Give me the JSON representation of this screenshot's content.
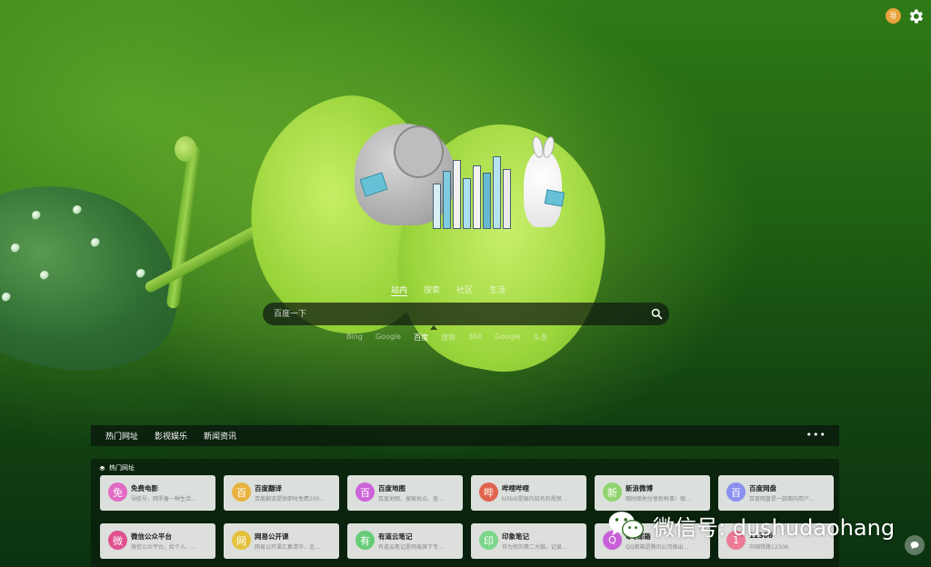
{
  "header": {
    "avatar_text": "导",
    "settings_icon": "gear-icon"
  },
  "search": {
    "tabs": [
      "站内",
      "搜索",
      "社区",
      "生活"
    ],
    "active_tab": "站内",
    "placeholder": "百度一下",
    "engines": [
      "Bing",
      "Google",
      "百度",
      "搜狗",
      "360",
      "Google",
      "头条"
    ],
    "active_engine": "百度"
  },
  "nav": {
    "tabs": [
      "热门网址",
      "影视娱乐",
      "新闻资讯"
    ],
    "more_label": "•••"
  },
  "panel": {
    "title": "热门网址",
    "cards": [
      {
        "icon": "免",
        "name": "免费电影",
        "desc": "导航号，网罗着一种生活…",
        "color": "#e06ac4"
      },
      {
        "icon": "百",
        "name": "百度翻译",
        "desc": "百度翻译提供即时免费200…",
        "color": "#e9b23f"
      },
      {
        "icon": "百",
        "name": "百度地图",
        "desc": "百度地图，搜索地点、查…",
        "color": "#cc64d9"
      },
      {
        "icon": "哔",
        "name": "哔哩哔哩",
        "desc": "bilibili是国内知名的视频…",
        "color": "#e0644d"
      },
      {
        "icon": "新",
        "name": "新浪微博",
        "desc": "随时随地分享新鲜事！微…",
        "color": "#8fd46f"
      },
      {
        "icon": "百",
        "name": "百度网盘",
        "desc": "百度网盘是一款面向用户…",
        "color": "#8a8ff0"
      },
      {
        "icon": "微",
        "name": "微信公众平台",
        "desc": "微信公众平台，给个人、…",
        "color": "#e0518e"
      },
      {
        "icon": "网",
        "name": "网易公开课",
        "desc": "网易公开课汇集清华、北…",
        "color": "#e4c23b"
      },
      {
        "icon": "有",
        "name": "有道云笔记",
        "desc": "有道云笔记是网易旗下专…",
        "color": "#67cc77"
      },
      {
        "icon": "印",
        "name": "印象笔记",
        "desc": "作为你的第二大脑，记录…",
        "color": "#7bd68b"
      },
      {
        "icon": "Q",
        "name": "QQ邮箱",
        "desc": "QQ邮箱是腾讯公司推出…",
        "color": "#c85fd8"
      },
      {
        "icon": "1",
        "name": "12306",
        "desc": "中国铁路12306",
        "color": "#ee7b96"
      }
    ]
  },
  "watermark": {
    "text": "微信号: dushudaohang"
  }
}
